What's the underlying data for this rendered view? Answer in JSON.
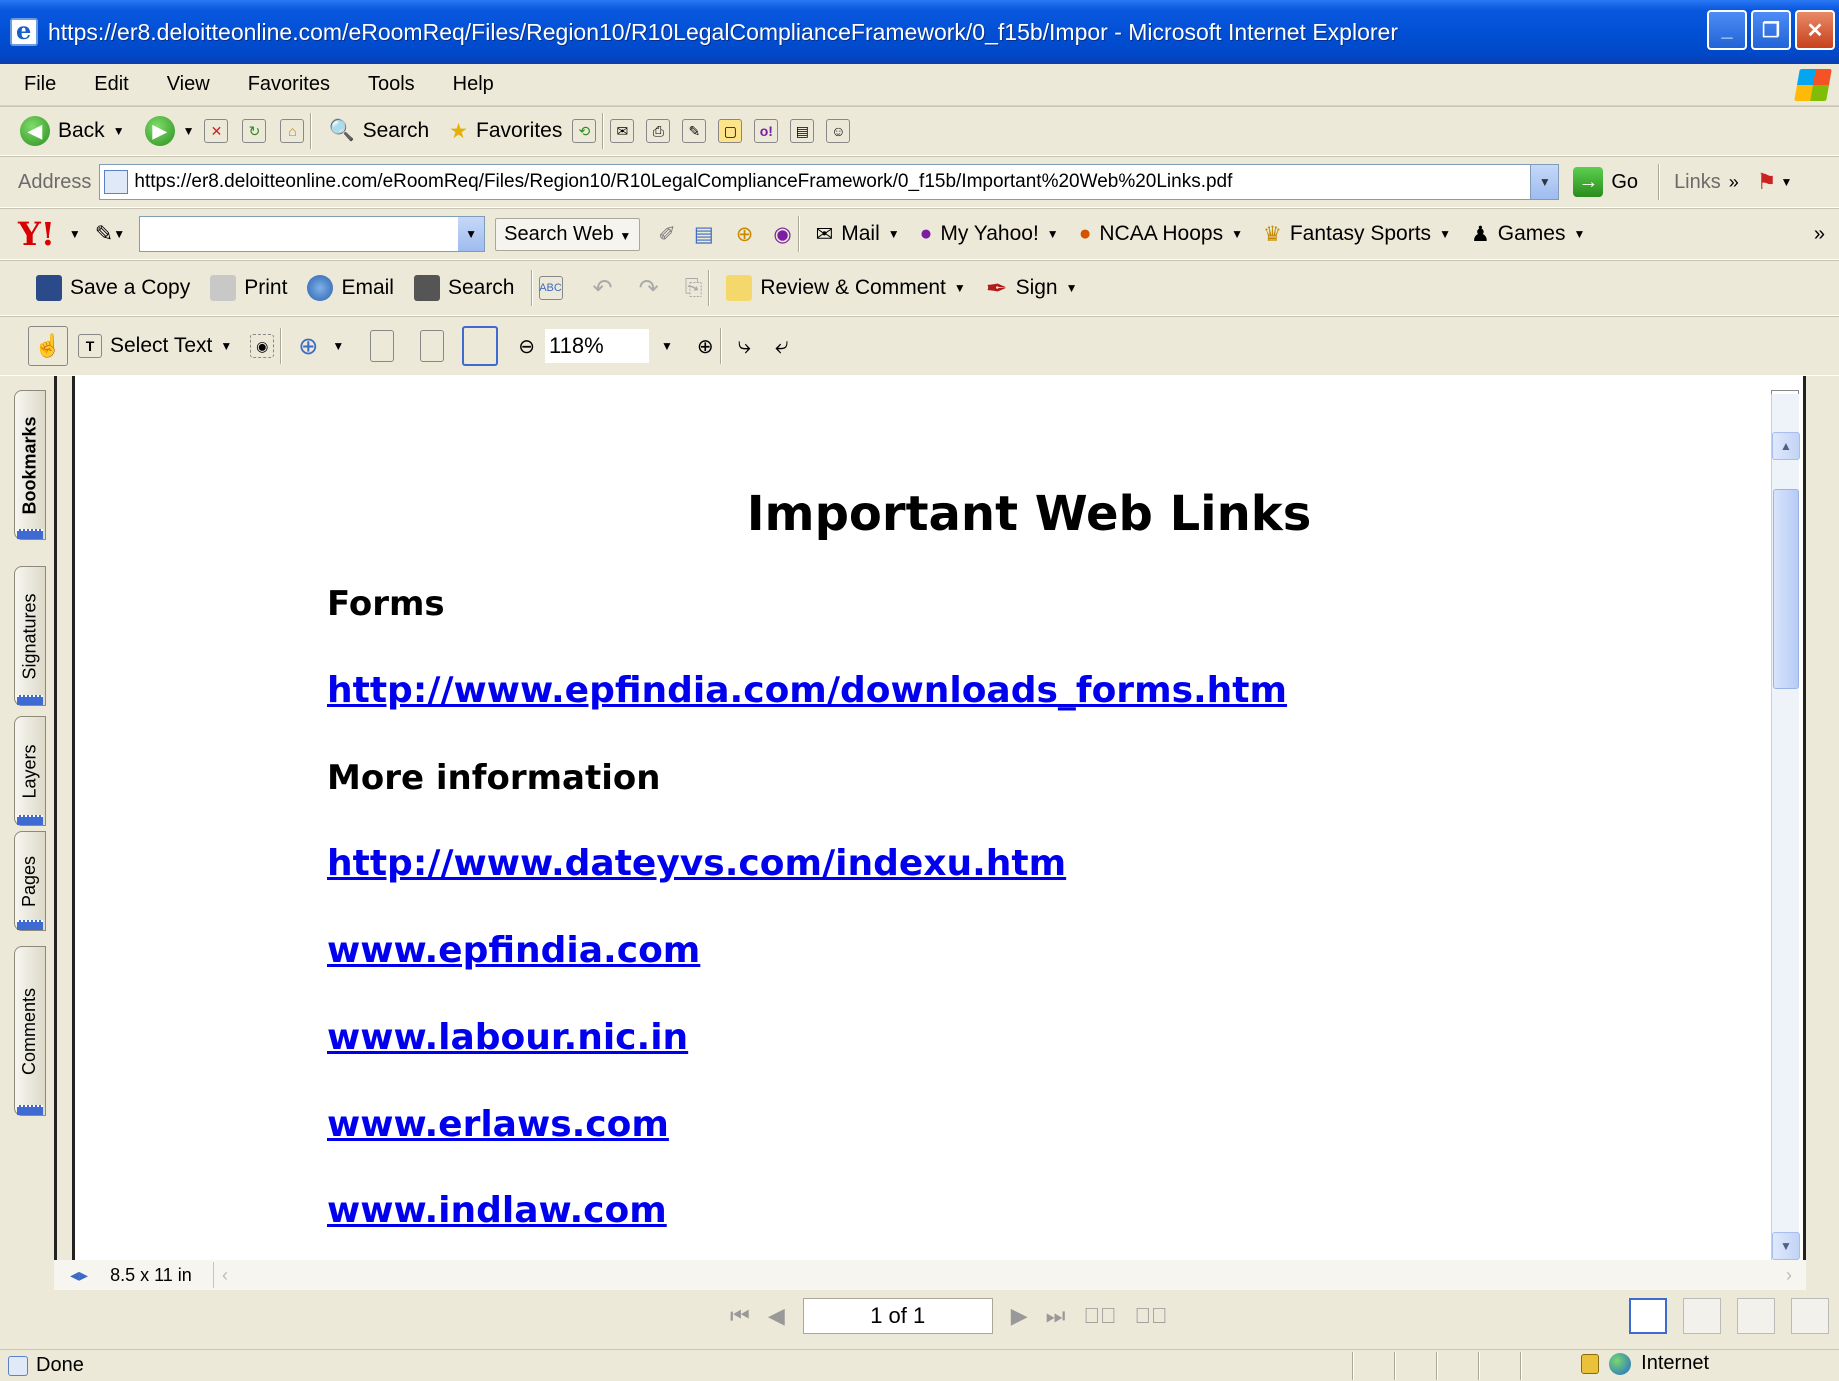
{
  "window": {
    "title": "https://er8.deloitteonline.com/eRoomReq/Files/Region10/R10LegalComplianceFramework/0_f15b/Impor - Microsoft Internet Explorer"
  },
  "menu": [
    "File",
    "Edit",
    "View",
    "Favorites",
    "Tools",
    "Help"
  ],
  "std_toolbar": {
    "back": "Back",
    "search": "Search",
    "favorites": "Favorites"
  },
  "address": {
    "label": "Address",
    "url": "https://er8.deloitteonline.com/eRoomReq/Files/Region10/R10LegalComplianceFramework/0_f15b/Important%20Web%20Links.pdf",
    "go": "Go",
    "links": "Links"
  },
  "yahoo_toolbar": {
    "search_web": "Search Web",
    "mail": "Mail",
    "my_yahoo": "My Yahoo!",
    "ncaa": "NCAA Hoops",
    "fantasy": "Fantasy Sports",
    "games": "Games"
  },
  "pdf_toolbar": {
    "save_copy": "Save a Copy",
    "print": "Print",
    "email": "Email",
    "search": "Search",
    "review": "Review & Comment",
    "sign": "Sign",
    "select_text": "Select Text",
    "zoom": "118%"
  },
  "side_tabs": [
    "Bookmarks",
    "Signatures",
    "Layers",
    "Pages",
    "Comments"
  ],
  "document": {
    "title": "Important Web Links",
    "heading_forms": "Forms",
    "link1": "http://www.epfindia.com/downloads_forms.htm",
    "heading_more": "More information",
    "link2": "http://www.dateyvs.com/indexu.htm",
    "link3": "www.epfindia.com",
    "link4": "www.labour.nic.in",
    "link5": "www.erlaws.com",
    "link6": "www.indlaw.com"
  },
  "page_size": "8.5 x 11 in",
  "page_nav": "1 of 1",
  "status": {
    "text": "Done",
    "zone": "Internet"
  }
}
